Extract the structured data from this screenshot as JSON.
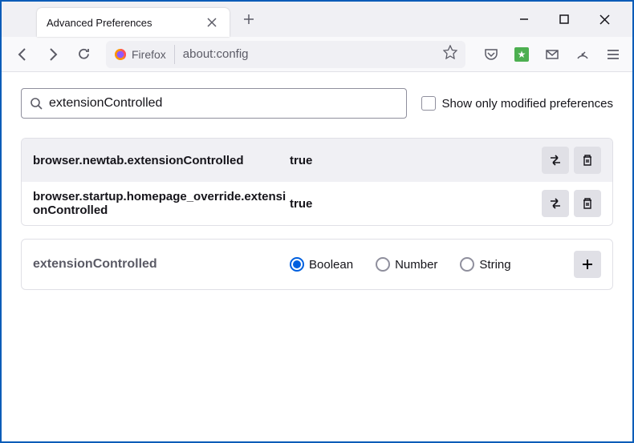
{
  "window": {
    "tab_title": "Advanced Preferences"
  },
  "urlbar": {
    "identity_label": "Firefox",
    "url": "about:config"
  },
  "search": {
    "value": "extensionControlled",
    "checkbox_label": "Show only modified preferences"
  },
  "prefs": [
    {
      "name": "browser.newtab.extensionControlled",
      "value": "true"
    },
    {
      "name": "browser.startup.homepage_override.extensionControlled",
      "value": "true"
    }
  ],
  "add": {
    "name": "extensionControlled",
    "types": [
      "Boolean",
      "Number",
      "String"
    ],
    "selected": "Boolean"
  }
}
